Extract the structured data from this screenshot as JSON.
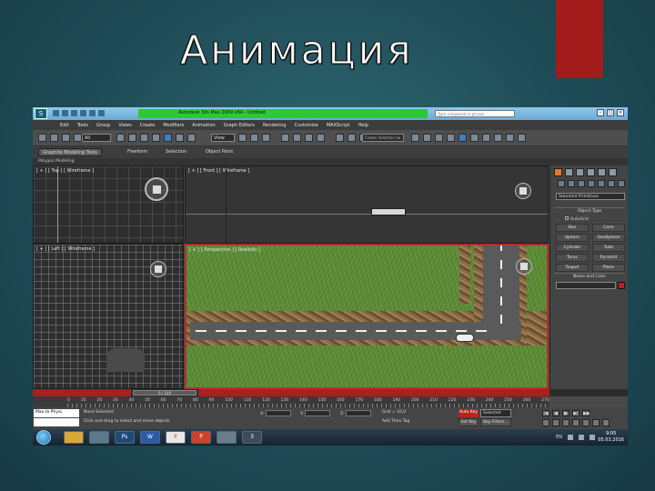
{
  "slide": {
    "title": "Анимация"
  },
  "window": {
    "title": "Autodesk 3ds Max  2009 x64 - Untitled",
    "help_search_placeholder": "Type a keyword or phrase",
    "controls": [
      "–",
      "□",
      "×"
    ]
  },
  "menu": [
    "Edit",
    "Tools",
    "Group",
    "Views",
    "Create",
    "Modifiers",
    "Animation",
    "Graph Editors",
    "Rendering",
    "Customize",
    "MAXScript",
    "Help"
  ],
  "toolbar": {
    "selection_filter": "All",
    "reference_coord": "View",
    "named_selection": "Create Selection Se"
  },
  "ribbon": {
    "tabs": [
      "Graphite Modeling Tools",
      "Freeform",
      "Selection",
      "Object Paint"
    ],
    "sub": "Polygon Modeling"
  },
  "viewports": {
    "top": "[ + ] [ Top ] [ Wireframe ]",
    "front": "[ + ] [ Front ] [ Wireframe ]",
    "left": "[ + ] [ Left ] [ Wireframe ]",
    "perspective": "[ + ] [ Perspective ] [ Realistic ]"
  },
  "command_panel": {
    "category": "Standard Primitives",
    "object_type_title": "Object Type",
    "autogrid": "AutoGrid",
    "objects": [
      "Box",
      "Cone",
      "Sphere",
      "GeoSphere",
      "Cylinder",
      "Tube",
      "Torus",
      "Pyramid",
      "Teapot",
      "Plane"
    ],
    "name_color_title": "Name and Color",
    "accent_color": "#b22222"
  },
  "timeline": {
    "slider": "0 / 100",
    "ticks": [
      "0",
      "10",
      "20",
      "30",
      "40",
      "50",
      "60",
      "70",
      "80",
      "90",
      "100",
      "110",
      "120",
      "130",
      "140",
      "150",
      "160",
      "170",
      "180",
      "190",
      "200",
      "210",
      "220",
      "230",
      "240",
      "250",
      "260",
      "270"
    ]
  },
  "status": {
    "maxscript_label": "Max to Physc",
    "message1": "None Selected",
    "message2": "Click and drag to select and move objects",
    "x_label": "X:",
    "y_label": "Y:",
    "z_label": "Z:",
    "grid": "Grid = 10,0",
    "add_time_tag": "Add Time Tag",
    "auto_key": "Auto Key",
    "selected": "Selected",
    "set_key": "Set Key",
    "key_filters": "Key Filters..."
  },
  "taskbar": {
    "apps": [
      "",
      "",
      "Ps",
      "W",
      "Y",
      "P",
      "",
      "3"
    ],
    "lang": "EN",
    "time": "9:05",
    "date": "05.03.2016"
  }
}
